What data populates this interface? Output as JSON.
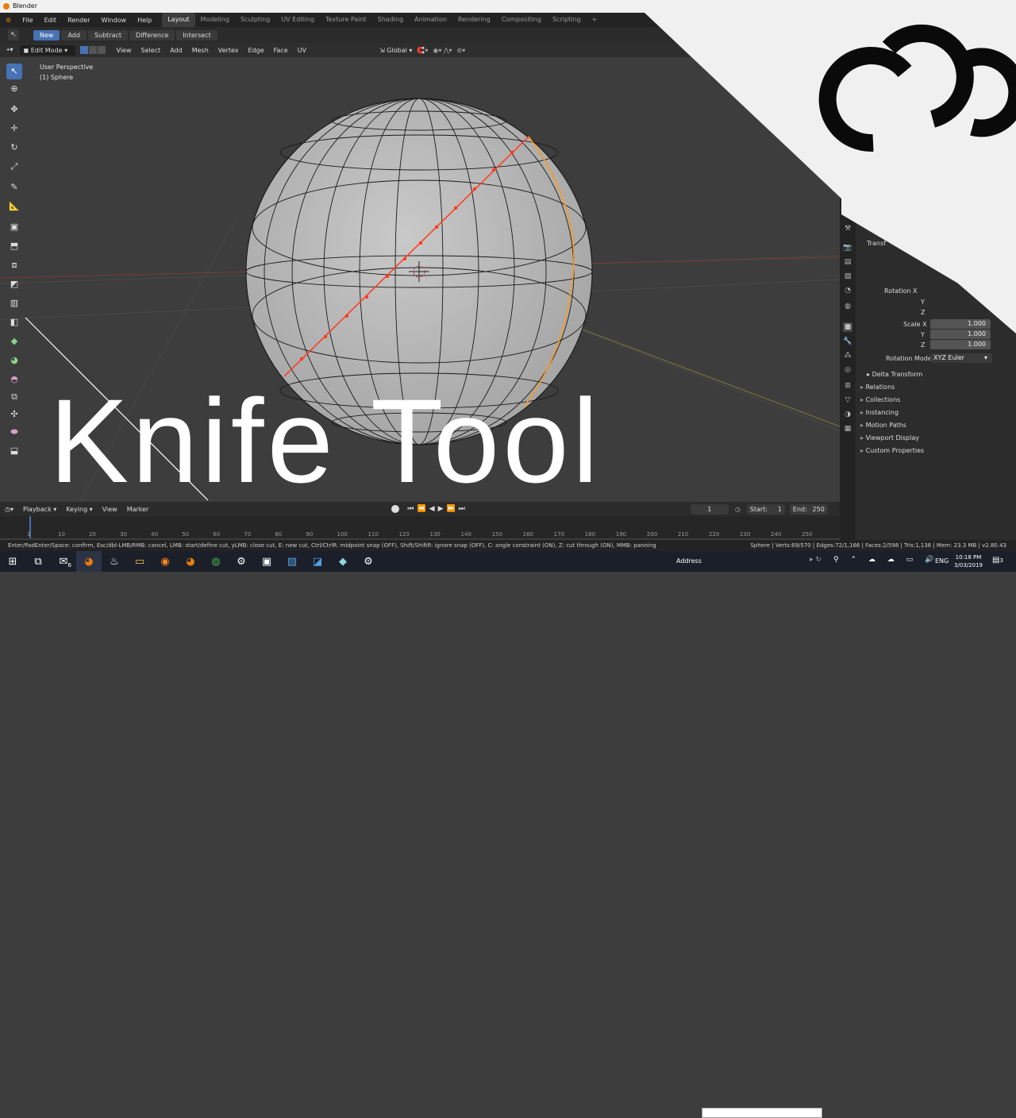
{
  "app": {
    "title": "Blender"
  },
  "menu": {
    "items": [
      "File",
      "Edit",
      "Render",
      "Window",
      "Help"
    ],
    "workspaces": [
      "Layout",
      "Modeling",
      "Sculpting",
      "UV Editing",
      "Texture Paint",
      "Shading",
      "Animation",
      "Rendering",
      "Compositing",
      "Scripting"
    ],
    "add_tab": "+"
  },
  "tool_header": {
    "buttons": [
      "New",
      "Add",
      "Subtract",
      "Difference",
      "Intersect"
    ]
  },
  "viewport_header": {
    "mode": "Edit Mode",
    "menus": [
      "View",
      "Select",
      "Add",
      "Mesh",
      "Vertex",
      "Edge",
      "Face",
      "UV"
    ],
    "orientation": "Global"
  },
  "viewport": {
    "perspective": "User Perspective",
    "object": "(1) Sphere"
  },
  "overlay_title": "Knife Tool",
  "properties": {
    "transform_label": "Transf",
    "rotation_x_label": "Rotation X",
    "y_label": "Y",
    "z_label": "Z",
    "scale_x_label": "Scale X",
    "scale_x": "1.000",
    "scale_y": "1.000",
    "scale_z": "1.000",
    "rotation_mode_label": "Rotation Mode",
    "rotation_mode": "XYZ Euler",
    "delta_transform": "Delta Transform",
    "sections": [
      "Relations",
      "Collections",
      "Instancing",
      "Motion Paths",
      "Viewport Display",
      "Custom Properties"
    ]
  },
  "timeline": {
    "menus": [
      "Playback",
      "Keying",
      "View",
      "Marker"
    ],
    "current_frame": "1",
    "start_label": "Start:",
    "start": "1",
    "end_label": "End:",
    "end": "250",
    "ticks": [
      "1",
      "10",
      "20",
      "30",
      "40",
      "50",
      "60",
      "70",
      "80",
      "90",
      "100",
      "110",
      "120",
      "130",
      "140",
      "150",
      "160",
      "170",
      "180",
      "190",
      "200",
      "210",
      "220",
      "230",
      "240",
      "250"
    ]
  },
  "status": {
    "hint": "Enter/PadEnter/Space: confirm, Esc/dbl-LMB/RMB: cancel, LMB: start/define cut, yLMB: close cut, E: new cut, Ctrl/CtrlR: midpoint snap (OFF), Shift/ShiftR: ignore snap (OFF), C: angle constraint (ON), Z: cut through (ON), MMB: panning",
    "stats": "Sphere | Verts:69/570 | Edges:72/1,166 | Faces:2/598 | Tris:1,136 | Mem: 23.3 MB | v2.80.43"
  },
  "taskbar": {
    "address_label": "Address",
    "lang": "ENG",
    "time": "10:18 PM",
    "date": "3/03/2019",
    "notification_count": "3",
    "badge": "6"
  },
  "colors": {
    "accent": "#4772b3",
    "selected_edge": "#ff3a1a",
    "active_edge": "#ff9a1a"
  }
}
